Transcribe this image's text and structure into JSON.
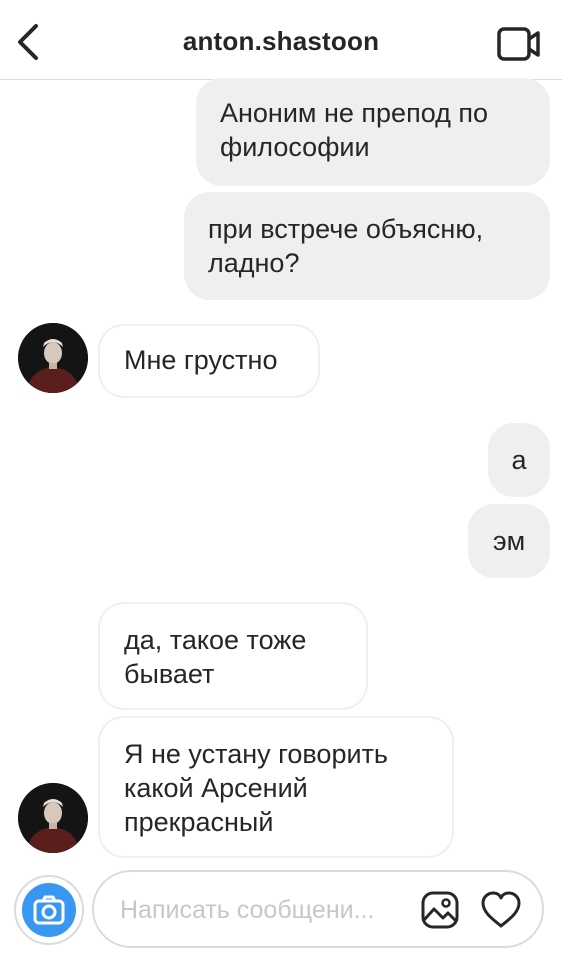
{
  "header": {
    "title": "anton.shastoon",
    "back_icon": "chevron-left-icon",
    "video_icon": "video-camera-icon"
  },
  "messages": [
    {
      "direction": "outgoing",
      "text": "Аноним не препод по\nфилософии"
    },
    {
      "direction": "outgoing",
      "text": "при встрече объясню,\nладно?"
    },
    {
      "direction": "incoming",
      "text": "Мне грустно",
      "avatar": true
    },
    {
      "direction": "outgoing",
      "text": "а"
    },
    {
      "direction": "outgoing",
      "text": "эм"
    },
    {
      "direction": "incoming",
      "text": "да, такое тоже\nбывает"
    },
    {
      "direction": "incoming",
      "text": "Я не устану говорить\nкакой Арсений\nпрекрасный",
      "avatar": true
    }
  ],
  "composer": {
    "placeholder": "Написать сообщени...",
    "camera_icon": "camera-icon",
    "gallery_icon": "gallery-icon",
    "like_icon": "heart-icon"
  },
  "colors": {
    "outgoing_bubble": "#efefef",
    "incoming_border": "#efefef",
    "camera_blue": "#3897f0",
    "divider": "#dbdbdb"
  }
}
